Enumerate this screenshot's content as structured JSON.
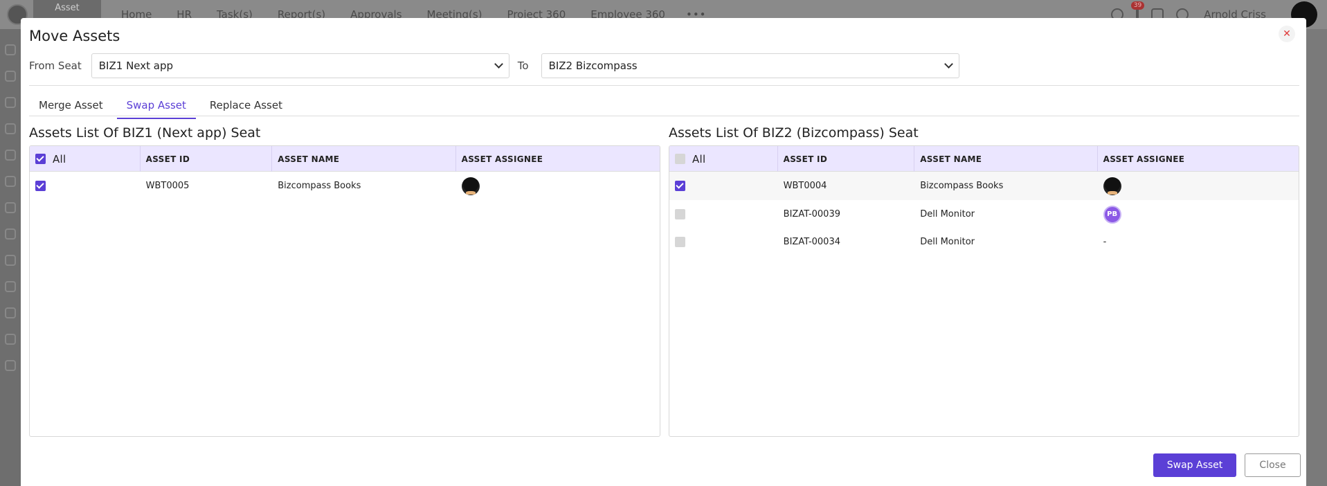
{
  "background_app": {
    "module_label": "Asset",
    "nav": [
      "Home",
      "HR",
      "Task(s)",
      "Report(s)",
      "Approvals",
      "Meeting(s)",
      "Project 360",
      "Employee 360"
    ],
    "more": "•••",
    "notification_count": "39",
    "user_name": "Arnold Criss"
  },
  "modal": {
    "title": "Move Assets",
    "close_glyph": "✕",
    "from_label": "From Seat",
    "from_value": "BIZ1 Next app",
    "to_label": "To",
    "to_value": "BIZ2 Bizcompass",
    "tabs": [
      {
        "label": "Merge Asset",
        "active": false
      },
      {
        "label": "Swap Asset",
        "active": true
      },
      {
        "label": "Replace Asset",
        "active": false
      }
    ],
    "left": {
      "title": "Assets List Of BIZ1 (Next app) Seat",
      "all_label": "All",
      "all_checked": true,
      "columns": [
        "ASSET ID",
        "ASSET NAME",
        "ASSET ASSIGNEE"
      ],
      "rows": [
        {
          "checked": true,
          "asset_id": "WBT0005",
          "asset_name": "Bizcompass Books",
          "assignee": "photo"
        }
      ]
    },
    "right": {
      "title": "Assets List Of BIZ2 (Bizcompass) Seat",
      "all_label": "All",
      "all_checked": false,
      "columns": [
        "ASSET ID",
        "ASSET NAME",
        "ASSET ASSIGNEE"
      ],
      "rows": [
        {
          "checked": true,
          "asset_id": "WBT0004",
          "asset_name": "Bizcompass Books",
          "assignee": "photo"
        },
        {
          "checked": false,
          "asset_id": "BIZAT-00039",
          "asset_name": "Dell Monitor",
          "assignee": "PB"
        },
        {
          "checked": false,
          "asset_id": "BIZAT-00034",
          "asset_name": "Dell Monitor",
          "assignee": "-"
        }
      ]
    },
    "primary_button": "Swap Asset",
    "secondary_button": "Close"
  },
  "colors": {
    "accent": "#5b3fd6",
    "header_bg": "#ebe6ff",
    "close_icon": "#e03b3b",
    "avatar_pb": "#8b59e6"
  }
}
